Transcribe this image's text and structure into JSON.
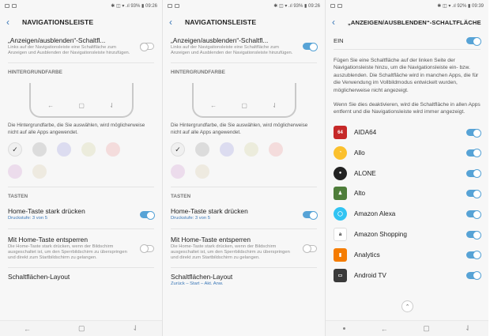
{
  "status": {
    "s1_right": "✱ ◫ ▾ .ıl 93% ▮ 09:26",
    "s2_right": "✱ ◫ ▾ .ıl 93% ▮ 09:26",
    "s3_right": "✱ ◫ ▾ .ıl 92% ▮ 09:39"
  },
  "screen1": {
    "title": "NAVIGATIONSLEISTE",
    "show_hide_title": "„Anzeigen/ausblenden“-Schaltfl...",
    "show_hide_desc": "Links auf der Navigationsleiste eine Schaltfläche zum Anzeigen und Ausblenden der Navigationsleiste hinzufügen.",
    "section_bg": "HINTERGRUNDFARBE",
    "bg_desc": "Die Hintergrundfarbe, die Sie auswählen, wird möglicherweise nicht auf alle Apps angewendet.",
    "section_keys": "TASTEN",
    "home_press_title": "Home-Taste stark drücken",
    "home_press_sub": "Druckstufe: 3 von 5",
    "unlock_title": "Mit Home-Taste entsperren",
    "unlock_desc": "Die Home-Taste stark drücken, wenn der Bildschirm ausgeschaltet ist, um den Sperrbildschirm zu überspringen und direkt zum Startbildschirm zu gelangen.",
    "layout_title": "Schaltflächen-Layout"
  },
  "screen2": {
    "title": "NAVIGATIONSLEISTE",
    "show_hide_title": "„Anzeigen/ausblenden“-Schaltfl...",
    "show_hide_desc": "Links auf der Navigationsleiste eine Schaltfläche zum Anzeigen und Ausblenden der Navigationsleiste hinzufügen.",
    "section_bg": "HINTERGRUNDFARBE",
    "bg_desc": "Die Hintergrundfarbe, die Sie auswählen, wird möglicherweise nicht auf alle Apps angewendet.",
    "section_keys": "TASTEN",
    "home_press_title": "Home-Taste stark drücken",
    "home_press_sub": "Druckstufe: 3 von 5",
    "unlock_title": "Mit Home-Taste entsperren",
    "unlock_desc": "Die Home-Taste stark drücken, wenn der Bildschirm ausgeschaltet ist, um den Sperrbildschirm zu überspringen und direkt zum Startbildschirm zu gelangen.",
    "layout_title": "Schaltflächen-Layout",
    "layout_sub": "Zurück – Start – Akt. Anw."
  },
  "screen3": {
    "title": "„ANZEIGEN/AUSBLENDEN“-SCHALTFLÄCHE",
    "ein": "EIN",
    "para1": "Fügen Sie eine Schaltfläche auf der linken Seite der Navigationsleiste hinzu, um die Navigationsleiste ein- bzw. auszublenden. Die Schaltfläche wird in manchen Apps, die für die Verwendung im Vollbildmodus entwickelt wurden, möglicherweise nicht angezeigt.",
    "para2": "Wenn Sie dies deaktivieren, wird die Schaltfläche in allen Apps entfernt und die Navigationsleiste wird immer angezeigt.",
    "apps": [
      {
        "name": "AIDA64",
        "icon": "aida64-icon",
        "color": "#c62828",
        "glyph": "64"
      },
      {
        "name": "Allo",
        "icon": "allo-icon",
        "color": "#fbc02d",
        "glyph": "◔"
      },
      {
        "name": "ALONE",
        "icon": "alone-icon",
        "color": "#222222",
        "glyph": "●"
      },
      {
        "name": "Alto",
        "icon": "alto-icon",
        "color": "#4e7d3a",
        "glyph": "♟"
      },
      {
        "name": "Amazon Alexa",
        "icon": "alexa-icon",
        "color": "#31c4f3",
        "glyph": "◯"
      },
      {
        "name": "Amazon Shopping",
        "icon": "amazon-icon",
        "color": "#ffffff",
        "glyph": "a"
      },
      {
        "name": "Analytics",
        "icon": "analytics-icon",
        "color": "#f57c00",
        "glyph": "▮"
      },
      {
        "name": "Android TV",
        "icon": "android-tv-icon",
        "color": "#3a3a3a",
        "glyph": "▭"
      }
    ]
  },
  "swatch_colors": [
    "#f0f0f0",
    "#dcdcdc",
    "#dcdcf0",
    "#ececdc",
    "#f4dcdc",
    "#ecdcec",
    "#eeeae0"
  ],
  "accent": "#57a3d6"
}
